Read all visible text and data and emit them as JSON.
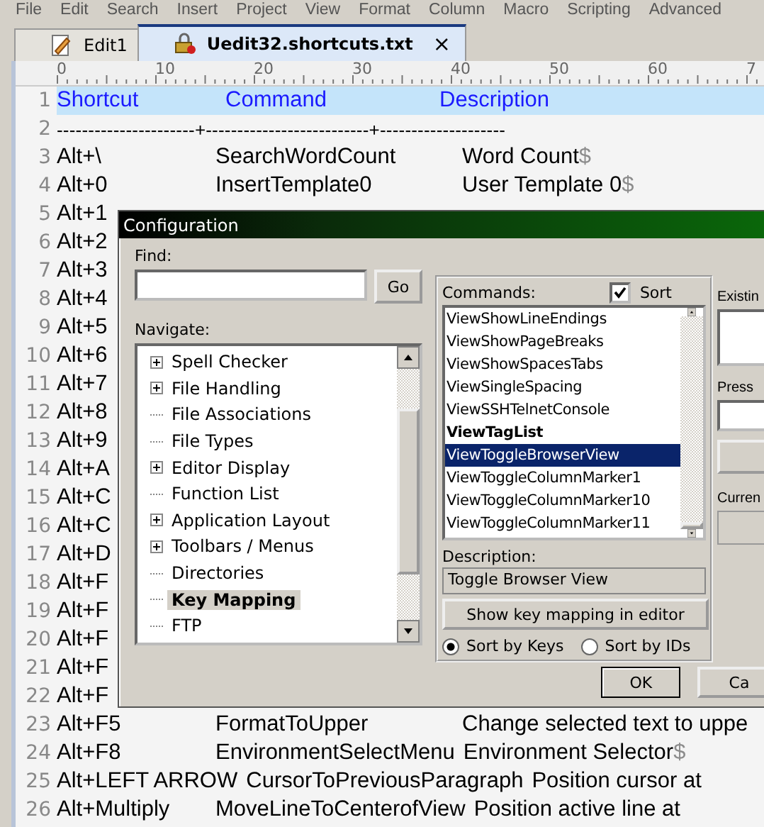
{
  "menu": [
    "File",
    "Edit",
    "Search",
    "Insert",
    "Project",
    "View",
    "Format",
    "Column",
    "Macro",
    "Scripting",
    "Advanced"
  ],
  "tabs": [
    {
      "label": "Edit1",
      "kind": "document",
      "selected": false
    },
    {
      "label": "Uedit32.shortcuts.txt",
      "kind": "locked",
      "selected": true,
      "close": "×"
    }
  ],
  "ruler": [
    "0",
    "10",
    "20",
    "30",
    "40",
    "50",
    "60",
    "7"
  ],
  "editor": {
    "lines": [
      {
        "number": "1",
        "kind": "header",
        "cells": [
          "Shortcut",
          "Command",
          "Description"
        ]
      },
      {
        "number": "2",
        "kind": "rule",
        "text": "----------------------+--------------------------+--------------------"
      },
      {
        "number": "3",
        "kind": "entry",
        "shortcut": "Alt+\\",
        "command": "SearchWordCount",
        "description": "Word Count",
        "eol": "$"
      },
      {
        "number": "4",
        "kind": "entry",
        "shortcut": "Alt+0",
        "command": "InsertTemplate0",
        "description": "User Template 0",
        "eol": "$"
      },
      {
        "number": "5",
        "kind": "entry",
        "shortcut": "Alt+1"
      },
      {
        "number": "6",
        "kind": "entry",
        "shortcut": "Alt+2"
      },
      {
        "number": "7",
        "kind": "entry",
        "shortcut": "Alt+3"
      },
      {
        "number": "8",
        "kind": "entry",
        "shortcut": "Alt+4"
      },
      {
        "number": "9",
        "kind": "entry",
        "shortcut": "Alt+5"
      },
      {
        "number": "10",
        "kind": "entry",
        "shortcut": "Alt+6"
      },
      {
        "number": "11",
        "kind": "entry",
        "shortcut": "Alt+7"
      },
      {
        "number": "12",
        "kind": "entry",
        "shortcut": "Alt+8"
      },
      {
        "number": "13",
        "kind": "entry",
        "shortcut": "Alt+9"
      },
      {
        "number": "14",
        "kind": "entry",
        "shortcut": "Alt+A"
      },
      {
        "number": "15",
        "kind": "entry",
        "shortcut": "Alt+C"
      },
      {
        "number": "16",
        "kind": "entry",
        "shortcut": "Alt+C"
      },
      {
        "number": "17",
        "kind": "entry",
        "shortcut": "Alt+D"
      },
      {
        "number": "18",
        "kind": "entry",
        "shortcut": "Alt+F"
      },
      {
        "number": "19",
        "kind": "entry",
        "shortcut": "Alt+F"
      },
      {
        "number": "20",
        "kind": "entry",
        "shortcut": "Alt+F"
      },
      {
        "number": "21",
        "kind": "entry",
        "shortcut": "Alt+F"
      },
      {
        "number": "22",
        "kind": "entry",
        "shortcut": "Alt+F"
      },
      {
        "number": "23",
        "kind": "entry",
        "shortcut": "Alt+F5",
        "command": "FormatToUpper",
        "description": "Change selected text to uppe"
      },
      {
        "number": "24",
        "kind": "entry",
        "shortcut": "Alt+F8",
        "command": "EnvironmentSelectMenu",
        "description": "Environment Selector",
        "eol": "$"
      },
      {
        "number": "25",
        "kind": "entry",
        "shortcut": "Alt+LEFT ARROW",
        "command": "CursorToPreviousParagraph",
        "description": "Position cursor at"
      },
      {
        "number": "26",
        "kind": "entry",
        "shortcut": "Alt+Multiply",
        "command": "MoveLineToCenterofView",
        "description": "Position active line at"
      }
    ]
  },
  "dialog": {
    "title": "Configuration",
    "find_label": "Find:",
    "find_button": "Go",
    "navigate_label": "Navigate:",
    "navigate_items": [
      {
        "label": "Spell Checker",
        "expandable": true,
        "selected": false
      },
      {
        "label": "File Handling",
        "expandable": true,
        "selected": false
      },
      {
        "label": "File Associations",
        "expandable": false,
        "selected": false
      },
      {
        "label": "File Types",
        "expandable": false,
        "selected": false
      },
      {
        "label": "Editor Display",
        "expandable": true,
        "selected": false
      },
      {
        "label": "Function List",
        "expandable": false,
        "selected": false
      },
      {
        "label": "Application Layout",
        "expandable": true,
        "selected": false
      },
      {
        "label": "Toolbars / Menus",
        "expandable": true,
        "selected": false
      },
      {
        "label": "Directories",
        "expandable": false,
        "selected": false
      },
      {
        "label": "Key Mapping",
        "expandable": false,
        "selected": true
      },
      {
        "label": "FTP",
        "expandable": false,
        "selected": false
      }
    ],
    "commands_label": "Commands:",
    "sort": {
      "label": "Sort",
      "checked": true
    },
    "commands": [
      {
        "label": "ViewShowLineEndings",
        "bold": false,
        "selected": false
      },
      {
        "label": "ViewShowPageBreaks",
        "bold": false,
        "selected": false
      },
      {
        "label": "ViewShowSpacesTabs",
        "bold": false,
        "selected": false
      },
      {
        "label": "ViewSingleSpacing",
        "bold": false,
        "selected": false
      },
      {
        "label": "ViewSSHTelnetConsole",
        "bold": false,
        "selected": false
      },
      {
        "label": "ViewTagList",
        "bold": true,
        "selected": false
      },
      {
        "label": "ViewToggleBrowserView",
        "bold": false,
        "selected": true
      },
      {
        "label": "ViewToggleColumnMarker1",
        "bold": false,
        "selected": false
      },
      {
        "label": "ViewToggleColumnMarker10",
        "bold": false,
        "selected": false
      },
      {
        "label": "ViewToggleColumnMarker11",
        "bold": false,
        "selected": false
      }
    ],
    "description_label": "Description:",
    "description": "Toggle Browser View",
    "show_button": "Show key mapping in editor",
    "sort_options": [
      {
        "label": "Sort by Keys",
        "selected": true
      },
      {
        "label": "Sort by IDs",
        "selected": false
      }
    ],
    "existing_label": "Existin",
    "press_label": "Press",
    "current_label": "Curren",
    "ok": "OK",
    "cancel": "Ca"
  }
}
